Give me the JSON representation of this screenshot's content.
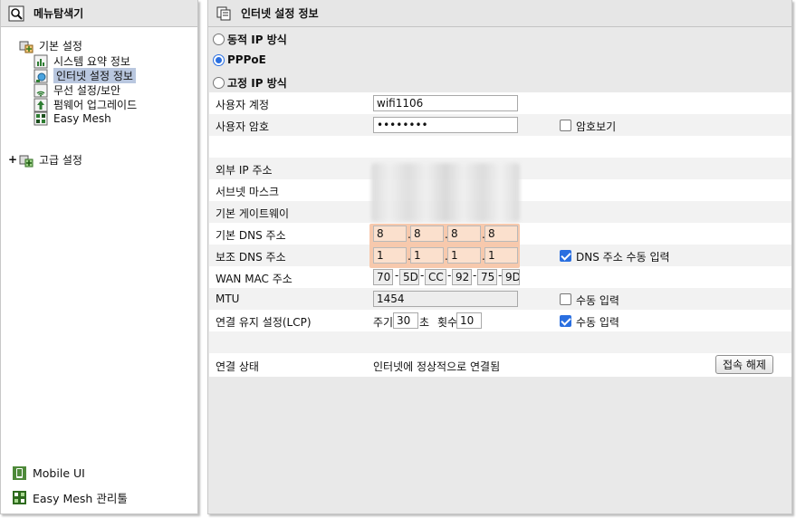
{
  "left": {
    "header": "메뉴탐색기",
    "tree": {
      "basic": "기본 설정",
      "items": [
        "시스템 요약 정보",
        "인터넷 설정 정보",
        "무선 설정/보안",
        "펌웨어 업그레이드",
        "Easy Mesh"
      ],
      "advanced_plus": "+",
      "advanced": "고급 설정"
    },
    "bottom": {
      "mobile": "Mobile UI",
      "mesh_tool": "Easy Mesh 관리툴"
    }
  },
  "main": {
    "header": "인터넷 설정 정보",
    "modes": [
      "동적 IP 방식",
      "PPPoE",
      "고정 IP 방식"
    ],
    "selected_mode": "PPPoE",
    "username_label": "사용자 계정",
    "username": "wifi1106",
    "password_label": "사용자 암호",
    "password": "••••••••",
    "show_password": "암호보기",
    "ext_ip_label": "외부 IP 주소",
    "subnet_label": "서브넷 마스크",
    "gateway_label": "기본 게이트웨이",
    "dns1_label": "기본 DNS 주소",
    "dns1": [
      "8",
      "8",
      "8",
      "8"
    ],
    "dns2_label": "보조 DNS 주소",
    "dns2": [
      "1",
      "1",
      "1",
      "1"
    ],
    "dns_manual": "DNS 주소 수동 입력",
    "dot": ".",
    "mac_label": "WAN MAC 주소",
    "mac": [
      "70",
      "5D",
      "CC",
      "92",
      "75",
      "9D"
    ],
    "dash": "-",
    "mtu_label": "MTU",
    "mtu": "1454",
    "mtu_manual": "수동 입력",
    "lcp_label": "연결 유지 설정(LCP)",
    "period_label": "주기",
    "period": "30",
    "seconds": "초",
    "count_label": "횟수",
    "count": "10",
    "lcp_manual": "수동 입력",
    "status_label": "연결 상태",
    "status": "인터넷에 정상적으로 연결됨",
    "disconnect": "접속 해제"
  }
}
